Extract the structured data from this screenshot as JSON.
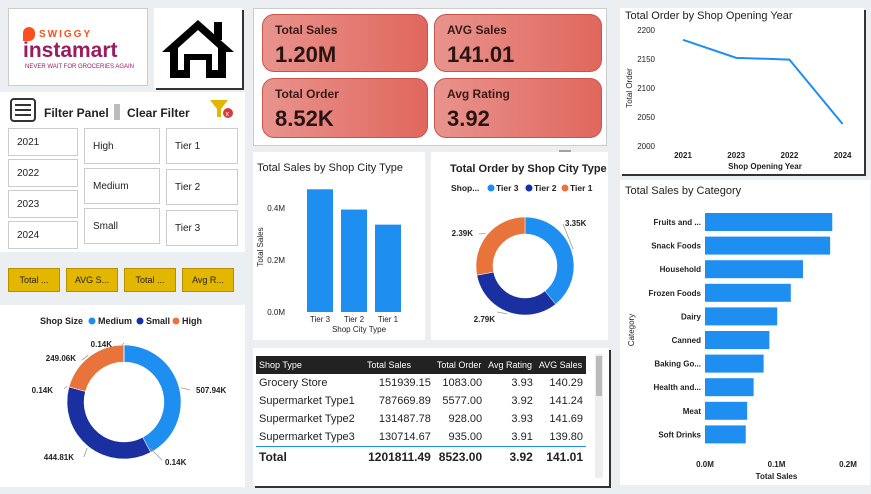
{
  "logo": {
    "brand": "SWIGGY",
    "name": "instamart",
    "tagline": "NEVER WAIT FOR GROCERIES AGAIN"
  },
  "filter": {
    "panel_label": "Filter Panel",
    "clear_label": "Clear Filter",
    "years": [
      "2021",
      "2022",
      "2023",
      "2024"
    ],
    "sizes": [
      "High",
      "Medium",
      "Small"
    ],
    "tiers": [
      "Tier 1",
      "Tier 2",
      "Tier 3"
    ],
    "kpi_buttons": [
      "Total ...",
      "AVG S...",
      "Total ...",
      "Avg R..."
    ]
  },
  "kpis": [
    {
      "label": "Total Sales",
      "value": "1.20M"
    },
    {
      "label": "AVG Sales",
      "value": "141.01"
    },
    {
      "label": "Total Order",
      "value": "8.52K"
    },
    {
      "label": "Avg Rating",
      "value": "3.92"
    }
  ],
  "chart_data": [
    {
      "type": "line",
      "title": "Total Order by Shop Opening Year",
      "xlabel": "Shop Opening Year",
      "ylabel": "Total Order",
      "x": [
        "2021",
        "2023",
        "2022",
        "2024"
      ],
      "values": [
        2183,
        2152,
        2149,
        2038
      ],
      "yticks": [
        "2200",
        "2150",
        "2100",
        "2050",
        "2000"
      ],
      "ylim": [
        2000,
        2200
      ],
      "color": "#1f8ef1"
    },
    {
      "type": "bar",
      "title": "Total Sales by Shop City Type",
      "xlabel": "Shop City Type",
      "ylabel": "Total Sales",
      "categories": [
        "Tier 3",
        "Tier 2",
        "Tier 1"
      ],
      "values": [
        472000,
        394000,
        336000
      ],
      "yticks": [
        "0.4M",
        "0.2M",
        "0.0M"
      ],
      "ylim": [
        0,
        500000
      ],
      "color": "#1f8ef1"
    },
    {
      "type": "pie",
      "title": "Total Order by Shop City Type",
      "legend_title": "Shop...",
      "slices": [
        {
          "name": "Tier 3",
          "value": 3.35,
          "label": "3.35K",
          "color": "#1f8ef1"
        },
        {
          "name": "Tier 2",
          "value": 2.79,
          "label": "2.79K",
          "color": "#1a2fa0"
        },
        {
          "name": "Tier 1",
          "value": 2.39,
          "label": "2.39K",
          "color": "#e8743b"
        }
      ]
    },
    {
      "type": "pie",
      "title": "",
      "legend_title": "Shop Size",
      "slices": [
        {
          "name": "Medium",
          "value": 507.94,
          "label": "507.94K",
          "color": "#1f8ef1"
        },
        {
          "name": "",
          "value": 0.14,
          "label": "0.14K",
          "color": "#1f8ef1"
        },
        {
          "name": "Small",
          "value": 444.81,
          "label": "444.81K",
          "color": "#1a2fa0"
        },
        {
          "name": "",
          "value": 0.14,
          "label": "0.14K",
          "color": "#1a2fa0"
        },
        {
          "name": "High",
          "value": 249.06,
          "label": "249.06K",
          "color": "#e8743b"
        },
        {
          "name": "",
          "value": 0.14,
          "label": "0.14K",
          "color": "#e8743b"
        }
      ]
    },
    {
      "type": "bar",
      "title": "Total Sales by Category",
      "orientation": "horizontal",
      "xlabel": "Total Sales",
      "ylabel": "Category",
      "categories": [
        "Fruits and ...",
        "Snack Foods",
        "Household",
        "Frozen Foods",
        "Dairy",
        "Canned",
        "Baking Go...",
        "Health and...",
        "Meat",
        "Soft Drinks"
      ],
      "values": [
        178000,
        175000,
        137000,
        120000,
        101000,
        90000,
        82000,
        68000,
        59000,
        57000
      ],
      "xticks": [
        "0.0M",
        "0.1M",
        "0.2M"
      ],
      "xlim": [
        0,
        200000
      ],
      "color": "#1f8ef1"
    }
  ],
  "table": {
    "headers": [
      "Shop Type",
      "Total Sales",
      "Total Order",
      "Avg Rating",
      "AVG Sales"
    ],
    "rows": [
      [
        "Grocery Store",
        "151939.15",
        "1083.00",
        "3.93",
        "140.29"
      ],
      [
        "Supermarket Type1",
        "787669.89",
        "5577.00",
        "3.92",
        "141.24"
      ],
      [
        "Supermarket Type2",
        "131487.78",
        "928.00",
        "3.93",
        "141.69"
      ],
      [
        "Supermarket Type3",
        "130714.67",
        "935.00",
        "3.91",
        "139.80"
      ]
    ],
    "total": [
      "Total",
      "1201811.49",
      "8523.00",
      "3.92",
      "141.01"
    ]
  }
}
